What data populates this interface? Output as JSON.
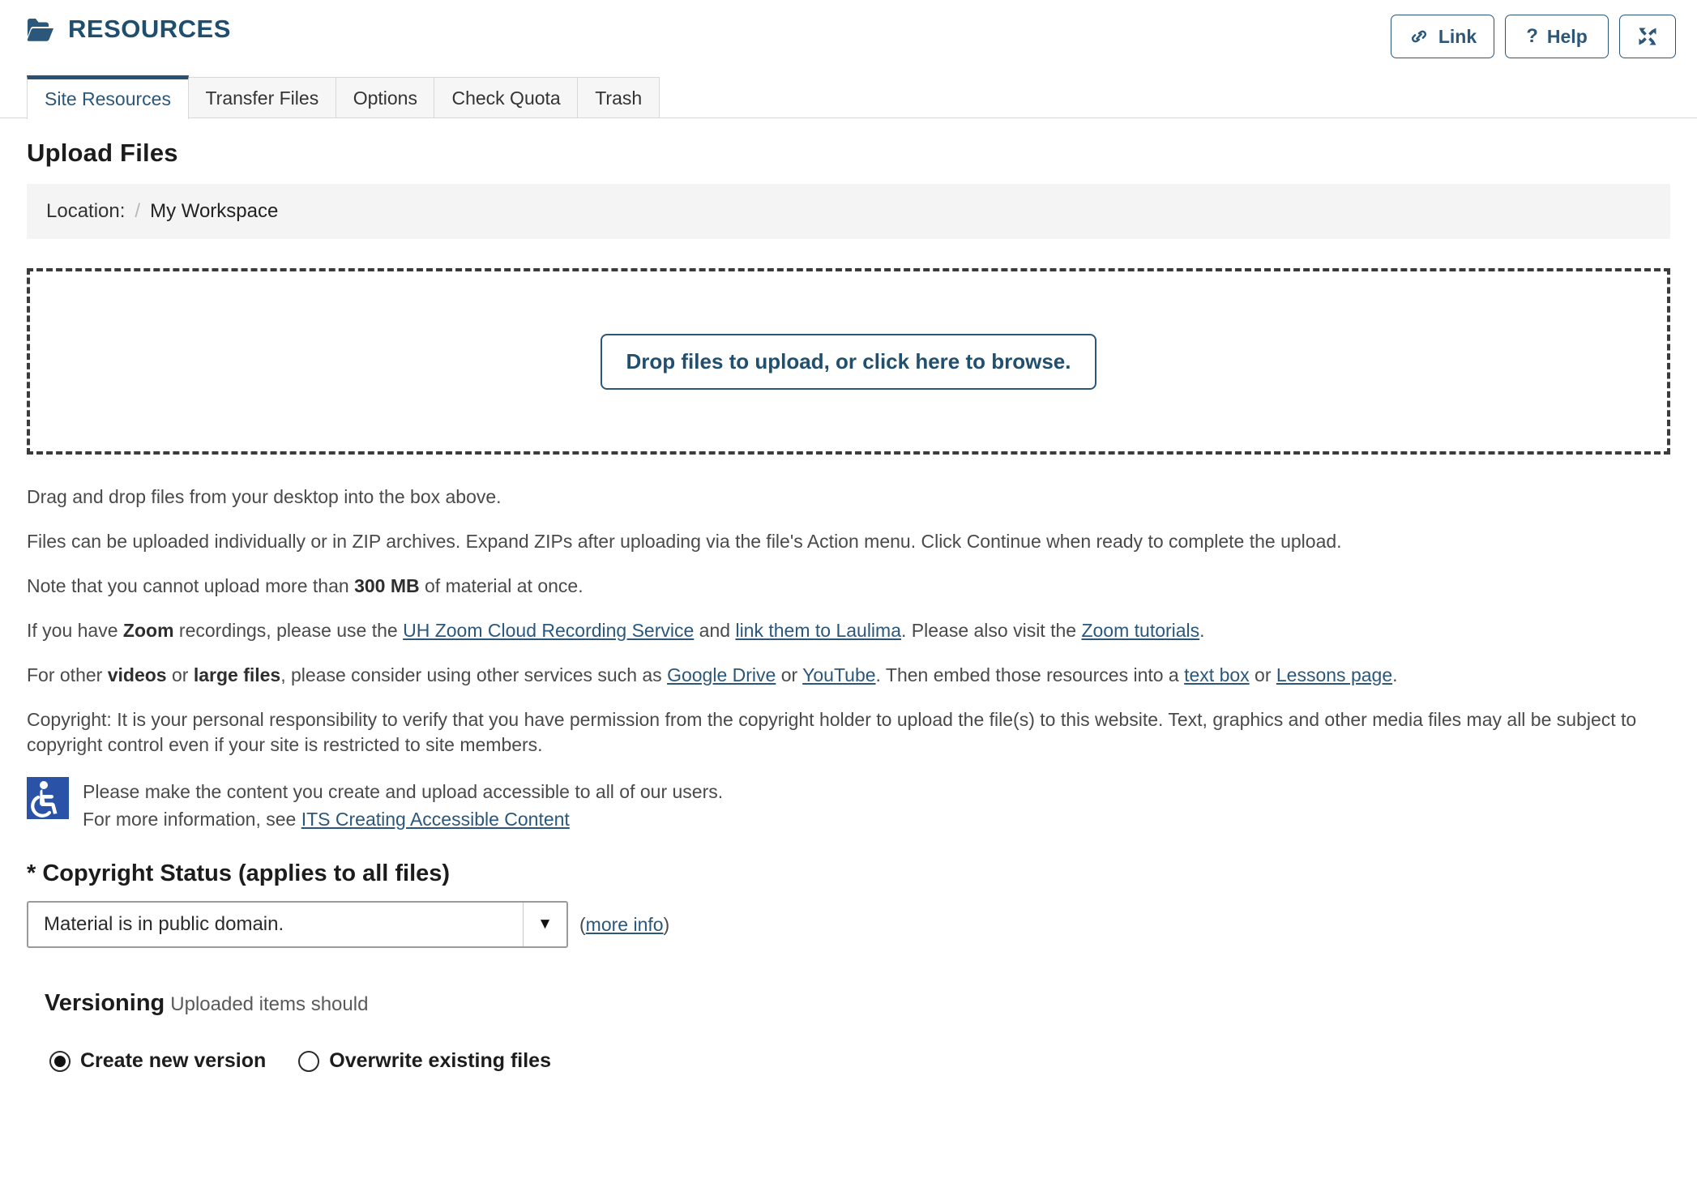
{
  "header": {
    "title": "RESOURCES",
    "folder_icon": "folder-open-icon",
    "buttons": [
      {
        "label": "Link",
        "icon": "chain-link-icon"
      },
      {
        "label": "Help",
        "icon": "question-mark-icon"
      },
      {
        "label": "",
        "icon": "expand-fullscreen-icon"
      }
    ]
  },
  "tabs": [
    {
      "label": "Site Resources",
      "active": true
    },
    {
      "label": "Transfer Files",
      "active": false
    },
    {
      "label": "Options",
      "active": false
    },
    {
      "label": "Check Quota",
      "active": false
    },
    {
      "label": "Trash",
      "active": false
    }
  ],
  "main": {
    "page_title": "Upload Files",
    "location": {
      "label": "Location:",
      "separator": "/",
      "value": "My Workspace"
    },
    "dropzone": {
      "button_label": "Drop files to upload, or click here to browse."
    },
    "paragraphs": {
      "p1": "Drag and drop files from your desktop into the box above.",
      "p2": "Files can be uploaded individually or in ZIP archives. Expand ZIPs after uploading via the file's Action menu. Click Continue when ready to complete the upload.",
      "p3_a": "Note that you cannot upload more than ",
      "p3_bold": "300 MB",
      "p3_b": " of material at once.",
      "p4_a": "If you have ",
      "p4_bold": "Zoom",
      "p4_b": " recordings, please use the ",
      "p4_link1": "UH Zoom Cloud Recording Service",
      "p4_c": " and ",
      "p4_link2": "link them to Laulima",
      "p4_d": ". Please also visit the ",
      "p4_link3": "Zoom tutorials",
      "p4_e": ".",
      "p5_a": "For other ",
      "p5_bold1": "videos",
      "p5_b": " or ",
      "p5_bold2": "large files",
      "p5_c": ", please consider using other services such as ",
      "p5_link1": "Google Drive",
      "p5_d": " or ",
      "p5_link2": "YouTube",
      "p5_e": ". Then embed those resources into a ",
      "p5_link3": "text box",
      "p5_f": " or ",
      "p5_link4": "Lessons page",
      "p5_g": ".",
      "p6": "Copyright: It is your personal responsibility to verify that you have permission from the copyright holder to upload the file(s) to this website. Text, graphics and other media files may all be subject to copyright control even if your site is restricted to site members."
    },
    "accessibility": {
      "icon": "wheelchair-accessibility-icon",
      "line1": "Please make the content you create and upload accessible to all of our users.",
      "line2_prefix": "For more information, see ",
      "line2_link": "ITS Creating Accessible Content"
    },
    "copyright_status": {
      "label": "* Copyright Status (applies to all files)",
      "selected": "Material is in public domain.",
      "caret": "▼",
      "more_info_open": "(",
      "more_info_link": "more info",
      "more_info_close": ")"
    },
    "versioning": {
      "title": "Versioning",
      "subtitle": "Uploaded items should",
      "options": [
        {
          "label": "Create new version",
          "selected": true
        },
        {
          "label": "Overwrite existing files",
          "selected": false
        }
      ]
    }
  },
  "colors": {
    "brand_blue": "#2b577a",
    "tab_active_border": "#2a5171",
    "link_blue": "#2b577a",
    "accessibility_blue": "#2a53a8"
  }
}
